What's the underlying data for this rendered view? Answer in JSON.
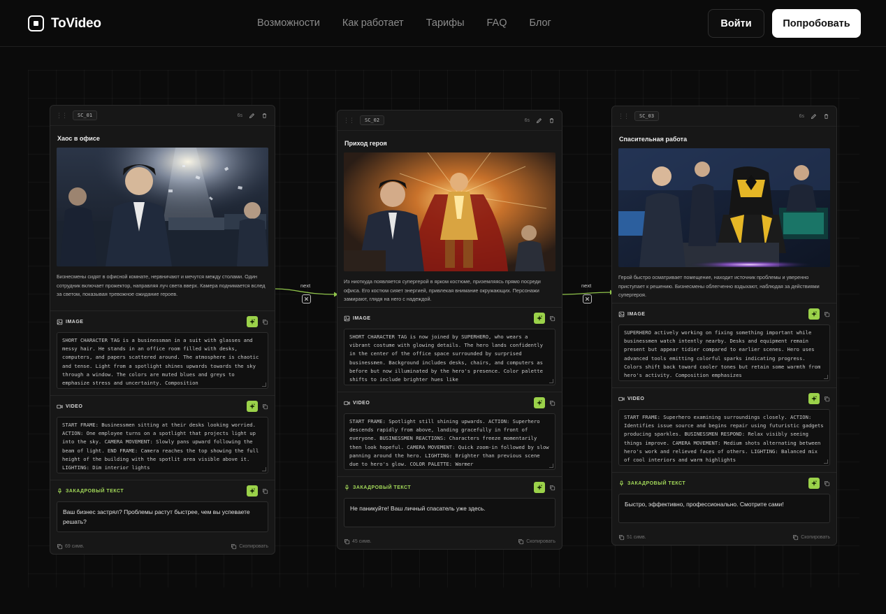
{
  "header": {
    "logo_text": "ToVideo",
    "nav": [
      "Возможности",
      "Как работает",
      "Тарифы",
      "FAQ",
      "Блог"
    ],
    "login_label": "Войти",
    "try_label": "Попробовать"
  },
  "colors": {
    "accent": "#9bd24a",
    "background": "#0b0b0b",
    "card": "#171717"
  },
  "connectors": [
    {
      "label": "next"
    },
    {
      "label": "next"
    }
  ],
  "scenes": [
    {
      "tag": "SC_01",
      "duration": "6s",
      "title": "Хаос в офисе",
      "description": "Бизнесмены сидят в офисной комнате, нервничают и мечутся между столами. Один сотрудник включает прожектор, направляя луч света вверх. Камера поднимается вслед за светом, показывая тревожное ожидание героев.",
      "image_label": "IMAGE",
      "image_prompt": "SHORT CHARACTER TAG is a businessman in a suit with glasses and messy hair. He stands in an office room filled with desks, computers, and papers scattered around. The atmosphere is chaotic and tense. Light from a spotlight shines upwards towards the sky through a window. The colors are muted blues and greys to emphasize stress and uncertainty. Composition",
      "video_label": "VIDEO",
      "video_prompt": "START FRAME: Businessmen sitting at their desks looking worried. ACTION: One employee turns on a spotlight that projects light up into the sky. CAMERA MOVEMENT: Slowly pans upward following the beam of light. END FRAME: Camera reaches the top showing the full height of the building with the spotlit area visible above it. LIGHTING: Dim interior lights",
      "voice_label": "ЗАКАДРОВЫЙ ТЕКСТ",
      "voice_text": "Ваш бизнес застрял? Проблемы растут быстрее, чем вы успеваете решать?",
      "char_count": "69 симв.",
      "copy_label": "Скопировать"
    },
    {
      "tag": "SC_02",
      "duration": "6s",
      "title": "Приход героя",
      "description": "Из ниоткуда появляется супергерой в ярком костюме, приземляясь прямо посреди офиса. Его костюм сияет энергией, привлекая внимание окружающих. Персонажи замирают, глядя на него с надеждой.",
      "image_label": "IMAGE",
      "image_prompt": "SHORT CHARACTER TAG is now joined by SUPERHERO, who wears a vibrant costume with glowing details. The hero lands confidently in the center of the office space surrounded by surprised businessmen. Background includes desks, chairs, and computers as before but now illuminated by the hero's presence. Color palette shifts to include brighter hues like",
      "video_label": "VIDEO",
      "video_prompt": "START FRAME: Spotlight still shining upwards. ACTION: Superhero descends rapidly from above, landing gracefully in front of everyone. BUSINESSMEN REACTIONS: Characters freeze momentarily then look hopeful. CAMERA MOVEMENT: Quick zoom-in followed by slow panning around the hero. LIGHTING: Brighter than previous scene due to hero's glow. COLOR PALETTE: Warmer",
      "voice_label": "ЗАКАДРОВЫЙ ТЕКСТ",
      "voice_text": "Не паникуйте! Ваш личный спасатель уже здесь.",
      "char_count": "45 симв.",
      "copy_label": "Скопировать"
    },
    {
      "tag": "SC_03",
      "duration": "6s",
      "title": "Спасительная работа",
      "description": "Герой быстро осматривает помещение, находит источник проблемы и уверенно приступает к решению. Бизнесмены облегченно вздыхают, наблюдая за действиями супергероя.",
      "image_label": "IMAGE",
      "image_prompt": "SUPERHERO actively working on fixing something important while businessmen watch intently nearby. Desks and equipment remain present but appear tidier compared to earlier scenes. Hero uses advanced tools emitting colorful sparks indicating progress. Colors shift back toward cooler tones but retain some warmth from hero's activity. Composition emphasizes",
      "video_label": "VIDEO",
      "video_prompt": "START FRAME: Superhero examining surroundings closely. ACTION: Identifies issue source and begins repair using futuristic gadgets producing sparkles. BUSINESSMEN RESPOND: Relax visibly seeing things improve. CAMERA MOVEMENT: Medium shots alternating between hero's work and relieved faces of others. LIGHTING: Balanced mix of cool interiors and warm highlights",
      "voice_label": "ЗАКАДРОВЫЙ ТЕКСТ",
      "voice_text": "Быстро, эффективно, профессионально. Смотрите сами!",
      "char_count": "51 симв.",
      "copy_label": "Скопировать"
    }
  ]
}
